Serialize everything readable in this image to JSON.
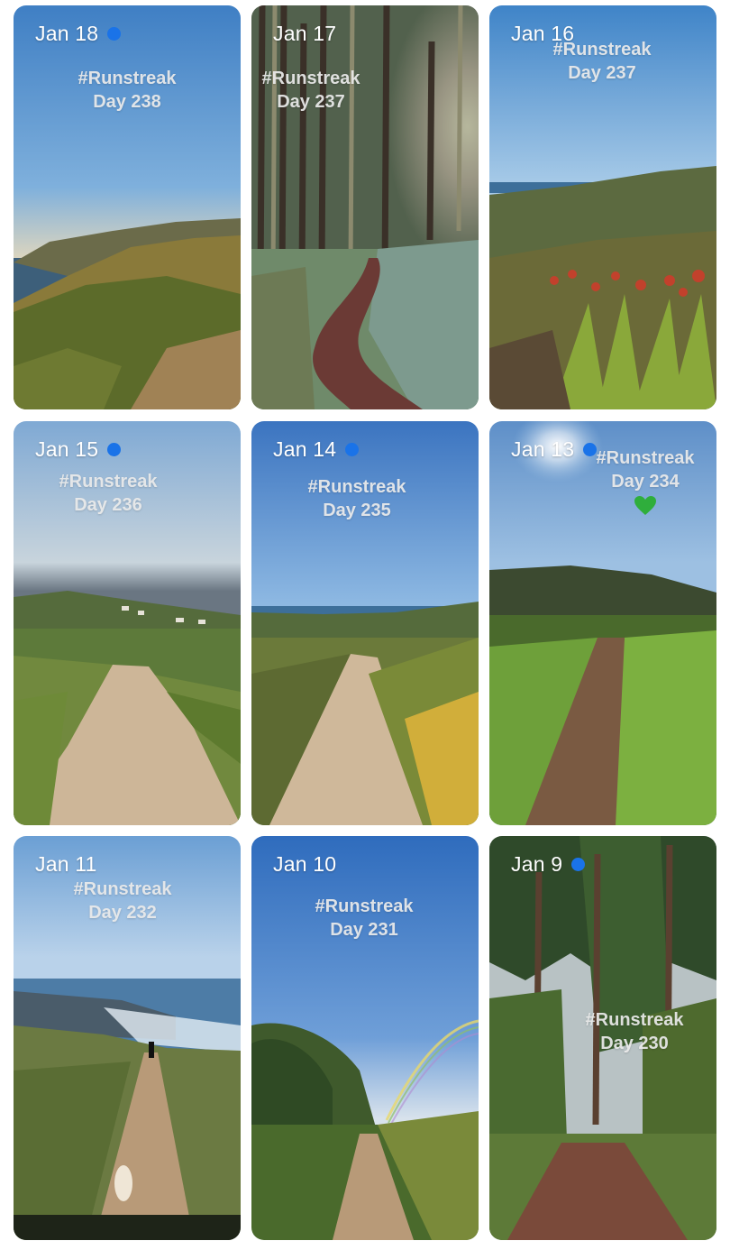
{
  "cards": [
    {
      "date": "Jan 18",
      "unread": true,
      "hashtag": "#Runstreak",
      "day": "Day 238",
      "scene": "coastal cliffs with heather"
    },
    {
      "date": "Jan 17",
      "unread": false,
      "hashtag": "#Runstreak",
      "day": "Day 237",
      "scene": "eucalyptus forest trail"
    },
    {
      "date": "Jan 16",
      "unread": false,
      "hashtag": "#Runstreak",
      "day": "Day 237",
      "scene": "hillside with red flowering aloes"
    },
    {
      "date": "Jan 15",
      "unread": true,
      "hashtag": "#Runstreak",
      "day": "Day 236",
      "scene": "dirt road to village"
    },
    {
      "date": "Jan 14",
      "unread": true,
      "hashtag": "#Runstreak",
      "day": "Day 235",
      "scene": "dirt road toward ocean"
    },
    {
      "date": "Jan 13",
      "unread": true,
      "hashtag": "#Runstreak",
      "day": "Day 234",
      "emoji": "green-heart",
      "scene": "grassy trail under sun"
    },
    {
      "date": "Jan 11",
      "unread": false,
      "hashtag": "#Runstreak",
      "day": "Day 232",
      "scene": "coastal path with dog"
    },
    {
      "date": "Jan 10",
      "unread": false,
      "hashtag": "#Runstreak",
      "day": "Day 231",
      "scene": "trail with rainbow"
    },
    {
      "date": "Jan 9",
      "unread": true,
      "hashtag": "#Runstreak",
      "day": "Day 230",
      "scene": "tall pine forest path"
    }
  ],
  "colors": {
    "unread_dot": "#1a73e8",
    "caption": "#ebebeb",
    "heart": "#2fae3c"
  }
}
